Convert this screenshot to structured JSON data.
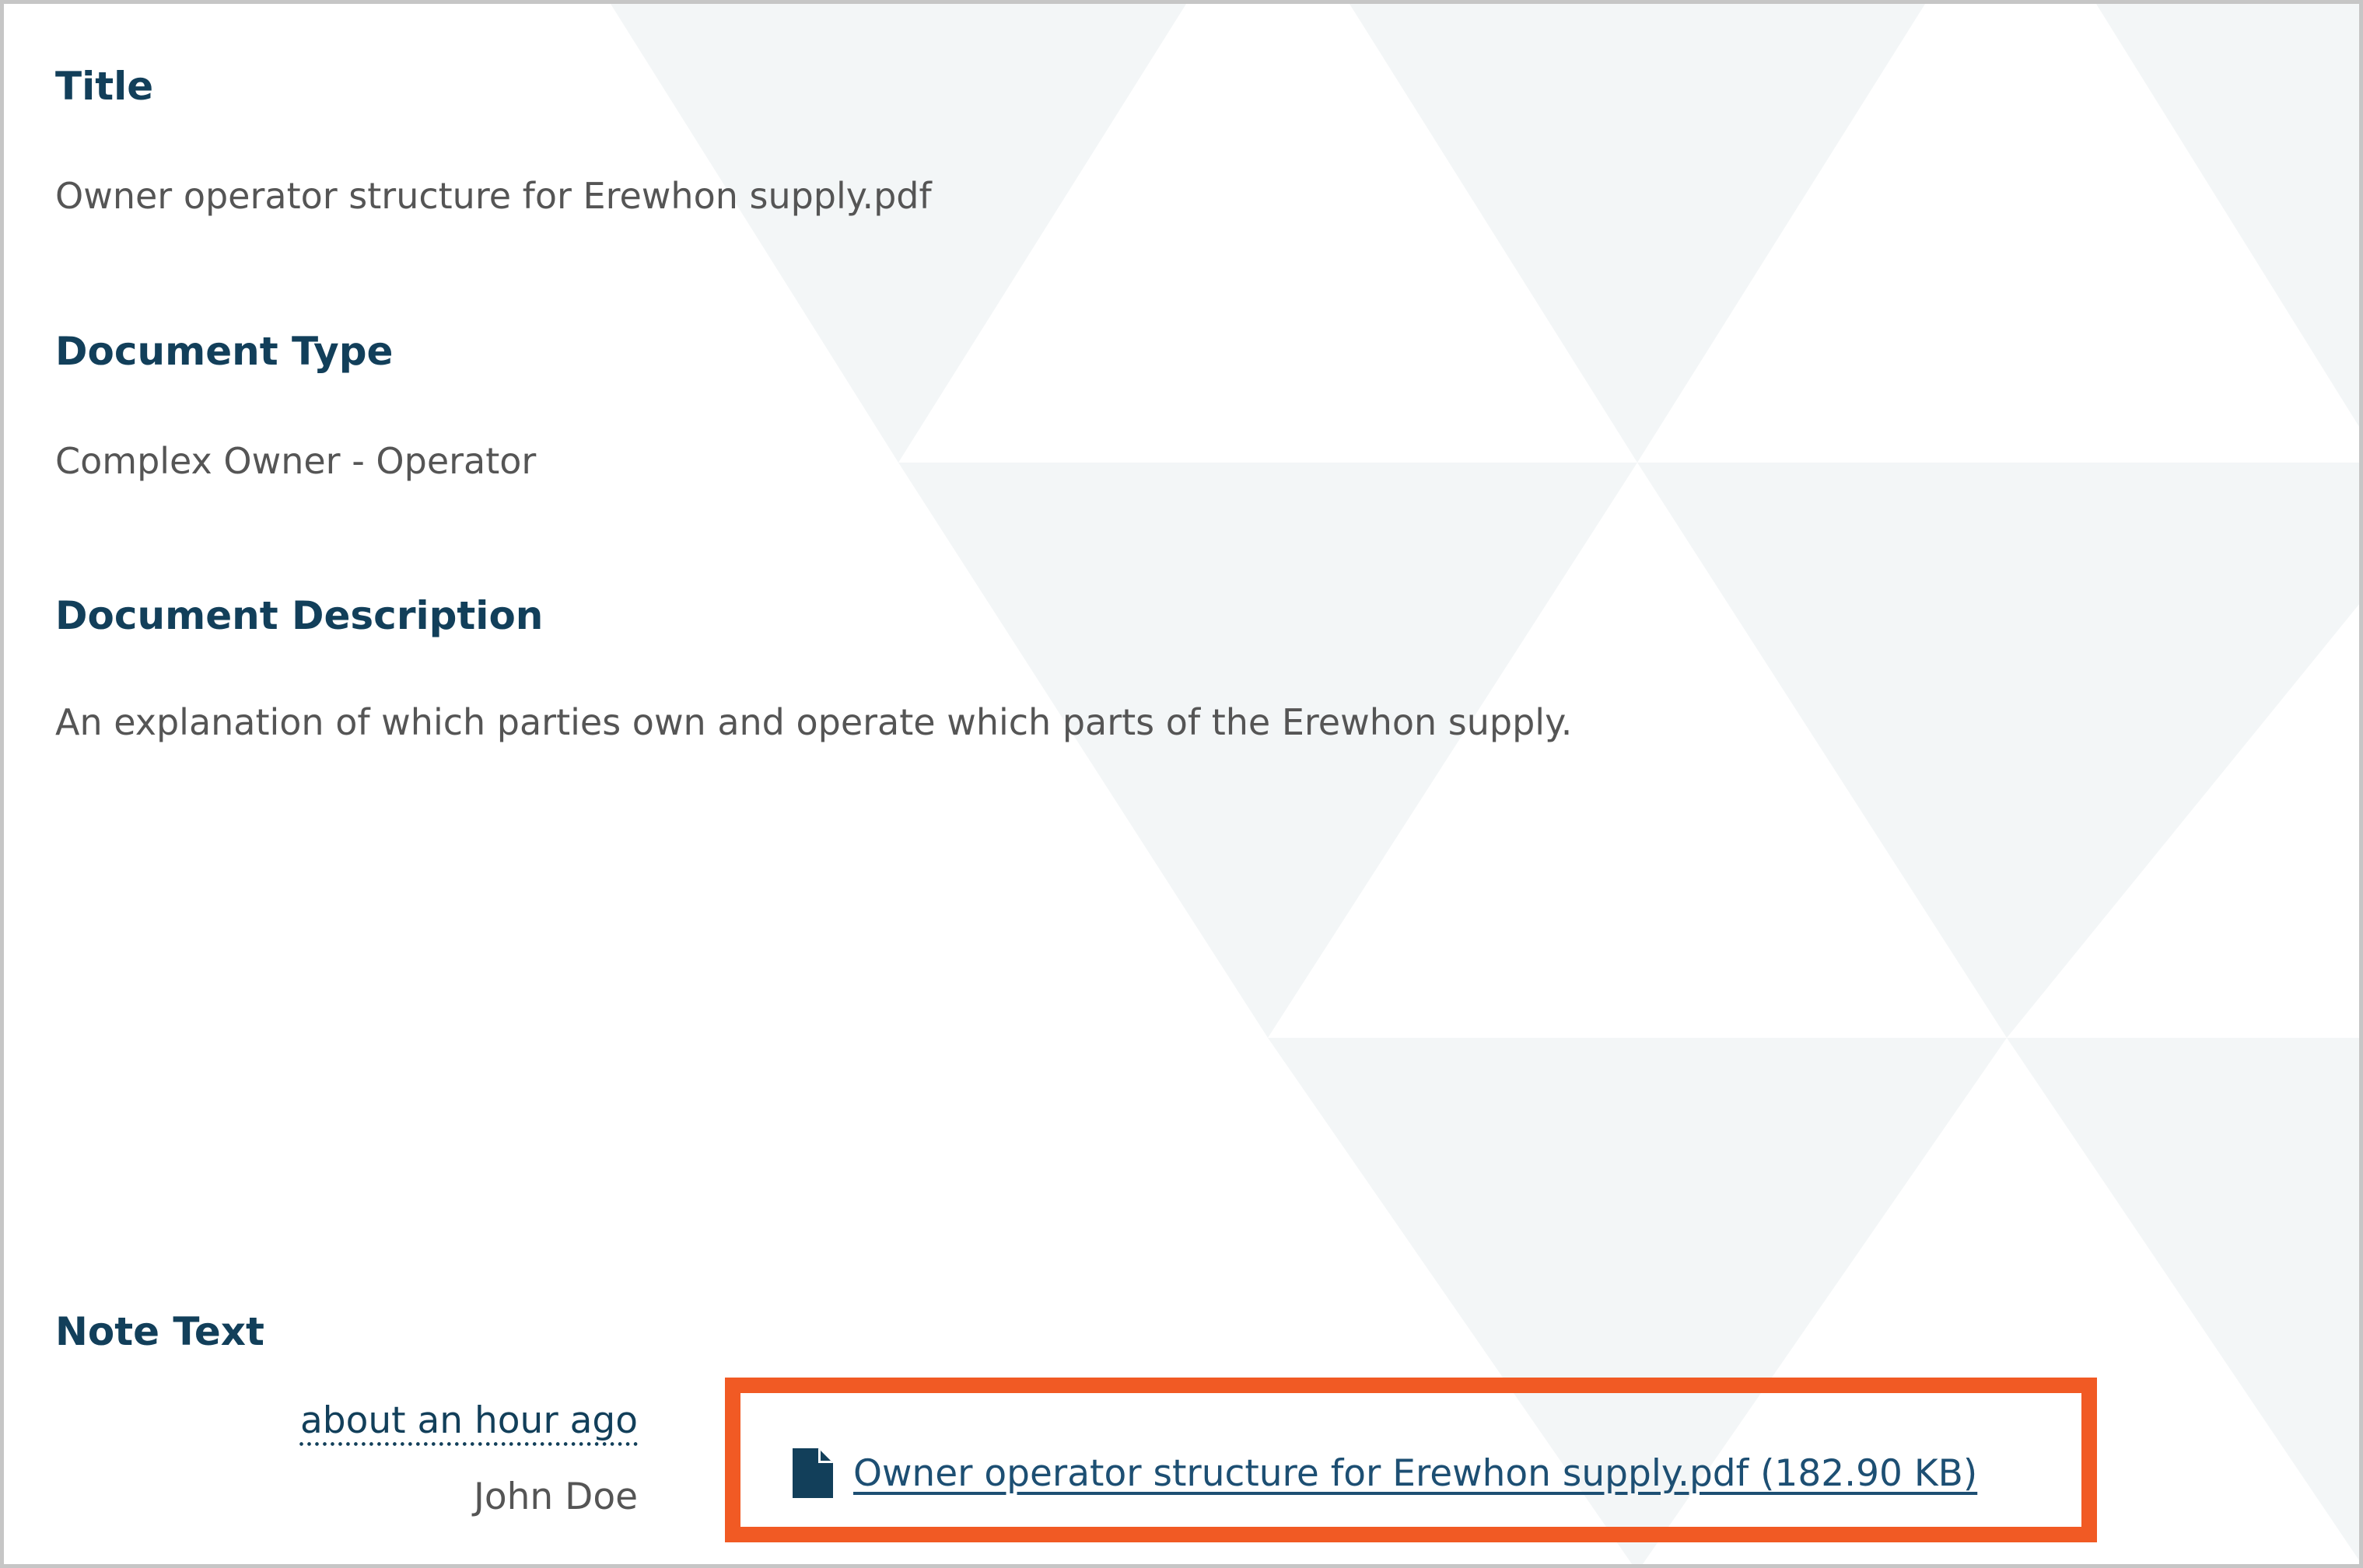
{
  "fields": {
    "title": {
      "label": "Title",
      "value": "Owner operator structure for Erewhon supply.pdf"
    },
    "document_type": {
      "label": "Document Type",
      "value": "Complex Owner - Operator"
    },
    "document_description": {
      "label": "Document Description",
      "value": "An explanation of which parties own and operate which parts of the Erewhon supply."
    }
  },
  "note": {
    "label": "Note Text",
    "timestamp": "about an hour ago",
    "author": "John Doe",
    "attachment": {
      "icon": "file-icon",
      "link_text": "Owner operator structure for Erewhon supply.pdf (182.90 KB)"
    }
  },
  "colors": {
    "label": "#123f5a",
    "value_text": "#555555",
    "link": "#1d4f73",
    "highlight": "#f15a24",
    "border": "#c6c6c6",
    "pattern": "#f3f6f7"
  }
}
